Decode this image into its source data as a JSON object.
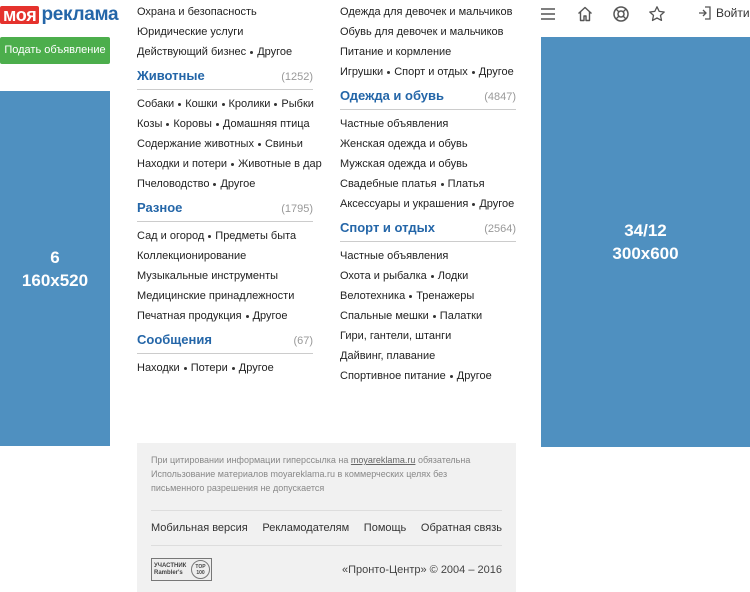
{
  "header": {
    "logo_part1": "моя",
    "logo_part2": "реклама",
    "post_button": "Подать объявление",
    "login_label": "Войти",
    "icons": [
      "menu-icon",
      "home-icon",
      "help-icon",
      "star-icon",
      "login-icon"
    ]
  },
  "banners": {
    "left": {
      "line1": "6",
      "line2": "160x520"
    },
    "right": {
      "line1": "34/12",
      "line2": "300x600"
    }
  },
  "col1": {
    "top_rows": [
      [
        "Охрана и безопасность"
      ],
      [
        "Юридические услуги"
      ],
      [
        "Действующий бизнес",
        "Другое"
      ]
    ],
    "sections": [
      {
        "title": "Животные",
        "count": "(1252)",
        "rows": [
          [
            "Собаки",
            "Кошки",
            "Кролики",
            "Рыбки"
          ],
          [
            "Козы",
            "Коровы",
            "Домашняя птица"
          ],
          [
            "Содержание животных",
            "Свиньи"
          ],
          [
            "Находки и потери",
            "Животные в дар"
          ],
          [
            "Пчеловодство",
            "Другое"
          ]
        ]
      },
      {
        "title": "Разное",
        "count": "(1795)",
        "rows": [
          [
            "Сад и огород",
            "Предметы быта"
          ],
          [
            "Коллекционирование"
          ],
          [
            "Музыкальные инструменты"
          ],
          [
            "Медицинские принадлежности"
          ],
          [
            "Печатная продукция",
            "Другое"
          ]
        ]
      },
      {
        "title": "Сообщения",
        "count": "(67)",
        "rows": [
          [
            "Находки",
            "Потери",
            "Другое"
          ]
        ]
      }
    ]
  },
  "col2": {
    "top_rows": [
      [
        "Одежда для девочек и мальчиков"
      ],
      [
        "Обувь для девочек и мальчиков"
      ],
      [
        "Питание и кормление"
      ],
      [
        "Игрушки",
        "Спорт и отдых",
        "Другое"
      ]
    ],
    "sections": [
      {
        "title": "Одежда и обувь",
        "count": "(4847)",
        "rows": [
          [
            "Частные объявления"
          ],
          [
            "Женская одежда и обувь"
          ],
          [
            "Мужская одежда и обувь"
          ],
          [
            "Свадебные платья",
            "Платья"
          ],
          [
            "Аксессуары и украшения",
            "Другое"
          ]
        ]
      },
      {
        "title": "Спорт и отдых",
        "count": "(2564)",
        "rows": [
          [
            "Частные объявления"
          ],
          [
            "Охота и рыбалка",
            "Лодки"
          ],
          [
            "Велотехника",
            "Тренажеры"
          ],
          [
            "Спальные мешки",
            "Палатки"
          ],
          [
            "Гири, гантели, штанги"
          ],
          [
            "Дайвинг, плавание"
          ],
          [
            "Спортивное питание",
            "Другое"
          ]
        ]
      }
    ]
  },
  "footer": {
    "note_prefix": "При цитировании информации гиперссылка на ",
    "note_link": "moyareklama.ru",
    "note_suffix": " обязательна",
    "note_line2": "Использование материалов moyareklama.ru в коммерческих целях без письменного разрешения не допускается",
    "links": [
      "Мобильная версия",
      "Рекламодателям",
      "Помощь",
      "Обратная связь"
    ],
    "rambler_line1": "УЧАСТНИК",
    "rambler_line2": "Rambler's",
    "rambler_top": "TOP 100",
    "copyright": "«Пронто-Центр» © 2004 – 2016"
  }
}
